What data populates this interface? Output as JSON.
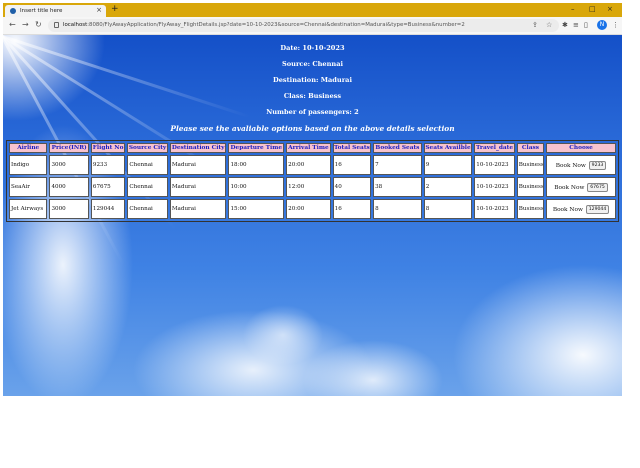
{
  "browser": {
    "tab_title": "Insert title here",
    "tab_close": "×",
    "new_tab": "+",
    "window_controls": [
      "–",
      "□",
      "×"
    ],
    "nav": {
      "back": "←",
      "forward": "→",
      "reload": "↻"
    },
    "url_host": "localhost",
    "url_rest": ":8080/FlyAwayApplication/FlyAway_FlightDetails.jsp?date=10-10-2023&source=Chennai&destination=Madurai&type=Business&number=2",
    "profile_initial": "N",
    "icons": [
      "lock-icon",
      "share-icon",
      "star-icon",
      "extension-icon",
      "reading-list-icon",
      "side-panel-icon",
      "profile-icon",
      "menu-icon"
    ]
  },
  "search": {
    "date_line": "Date: 10-10-2023",
    "source_line": "Source: Chennai",
    "destination_line": "Destination: Madurai",
    "class_line": "Class: Business",
    "passengers_line": "Number of passengers: 2",
    "instruction": "Please see the avaliable options based on the above details selection"
  },
  "table": {
    "headers": [
      "Airline",
      "Price(INR)",
      "Flight No",
      "Source City",
      "Destination City",
      "Departure Time",
      "Arrival Time",
      "Total Seats",
      "Booked Seats",
      "Seats Availble",
      "Travel_date",
      "Class",
      "Choose"
    ],
    "rows": [
      {
        "airline": "Indigo",
        "price": "3000",
        "flight_no": "9233",
        "source": "Chennai",
        "destination": "Madurai",
        "departure": "18:00",
        "arrival": "20:00",
        "total_seats": "16",
        "booked_seats": "7",
        "seats_available": "9",
        "travel_date": "10-10-2023",
        "class": "Business",
        "book_label": "Book Now",
        "book_button": "9233"
      },
      {
        "airline": "SeaAir",
        "price": "4000",
        "flight_no": "67675",
        "source": "Chennai",
        "destination": "Madurai",
        "departure": "10:00",
        "arrival": "12:00",
        "total_seats": "40",
        "booked_seats": "38",
        "seats_available": "2",
        "travel_date": "10-10-2023",
        "class": "Business",
        "book_label": "Book Now",
        "book_button": "67675"
      },
      {
        "airline": "Jet Airways",
        "price": "3000",
        "flight_no": "129044",
        "source": "Chennai",
        "destination": "Madurai",
        "departure": "15:00",
        "arrival": "20:00",
        "total_seats": "16",
        "booked_seats": "8",
        "seats_available": "8",
        "travel_date": "10-10-2023",
        "class": "Business",
        "book_label": "Book Now",
        "book_button": "129044"
      }
    ]
  }
}
